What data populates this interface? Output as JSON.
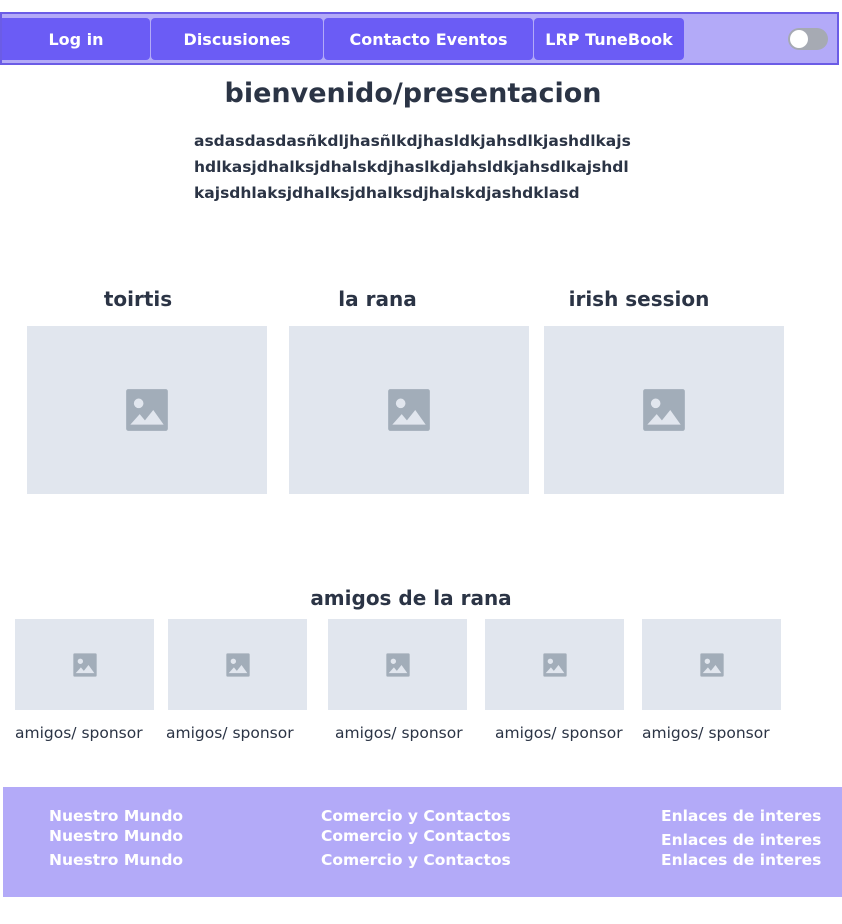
{
  "nav": {
    "items": [
      {
        "label": "Log in"
      },
      {
        "label": "Discusiones"
      },
      {
        "label": "Contacto Eventos"
      },
      {
        "label": "LRP TuneBook"
      }
    ]
  },
  "welcome": {
    "title": "bienvenido/presentacion",
    "lines": [
      "asdasdasdasñkdljhasñlkdjhasldkjahsdlkjashdlkajs",
      "hdlkasjdhalksjdhalskdjhaslkdjahsldkjahsdlkajshdl",
      "kajsdhlaksjdhalksjdhalksdjhalskdjashdklasd"
    ]
  },
  "features": [
    {
      "title": "toirtis"
    },
    {
      "title": "la rana"
    },
    {
      "title": "irish session"
    }
  ],
  "friends": {
    "title": "amigos de la rana",
    "items": [
      {
        "caption": "amigos/ sponsor"
      },
      {
        "caption": "amigos/ sponsor"
      },
      {
        "caption": "amigos/ sponsor"
      },
      {
        "caption": "amigos/ sponsor"
      },
      {
        "caption": "amigos/ sponsor"
      }
    ]
  },
  "footer": {
    "col1": [
      "Nuestro Mundo",
      "Nuestro Mundo",
      "Nuestro Mundo"
    ],
    "col2": [
      "Comercio y Contactos",
      "Comercio y Contactos",
      "Comercio y Contactos"
    ],
    "col3": [
      "Enlaces de interes",
      "Enlaces de interes",
      "Enlaces de interes"
    ]
  },
  "colors": {
    "accent": "#6b5cf5",
    "nav_background": "#b3aaf8",
    "placeholder": "#e1e6ee",
    "text": "#2b3445"
  },
  "icons": {
    "placeholder": "image-icon",
    "theme_toggle": "toggle-switch"
  }
}
